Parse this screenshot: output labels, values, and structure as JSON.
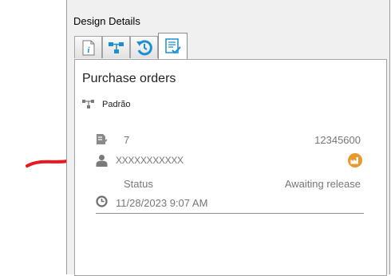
{
  "window": {
    "title": "Design Details"
  },
  "tabs": [
    {
      "name": "info",
      "icon": "info-icon",
      "active": false
    },
    {
      "name": "flow",
      "icon": "flow-icon",
      "active": false
    },
    {
      "name": "history",
      "icon": "history-icon",
      "active": false
    },
    {
      "name": "orders",
      "icon": "checklist-icon",
      "active": true
    }
  ],
  "section": {
    "title": "Purchase orders",
    "process": {
      "icon": "flow-icon",
      "label": "Padrão"
    }
  },
  "order": {
    "count": "7",
    "number": "12345600",
    "supplier": "XXXXXXXXXXX",
    "status_label": "Status",
    "status_value": "Awaiting release",
    "datetime": "11/28/2023 9:07 AM",
    "supplier_badge_icon": "factory-icon"
  },
  "annotation": {
    "icon": "red-arrow-icon",
    "color": "#e8181e"
  },
  "colors": {
    "accent": "#1b8fcf",
    "badge": "#e89a2c"
  }
}
